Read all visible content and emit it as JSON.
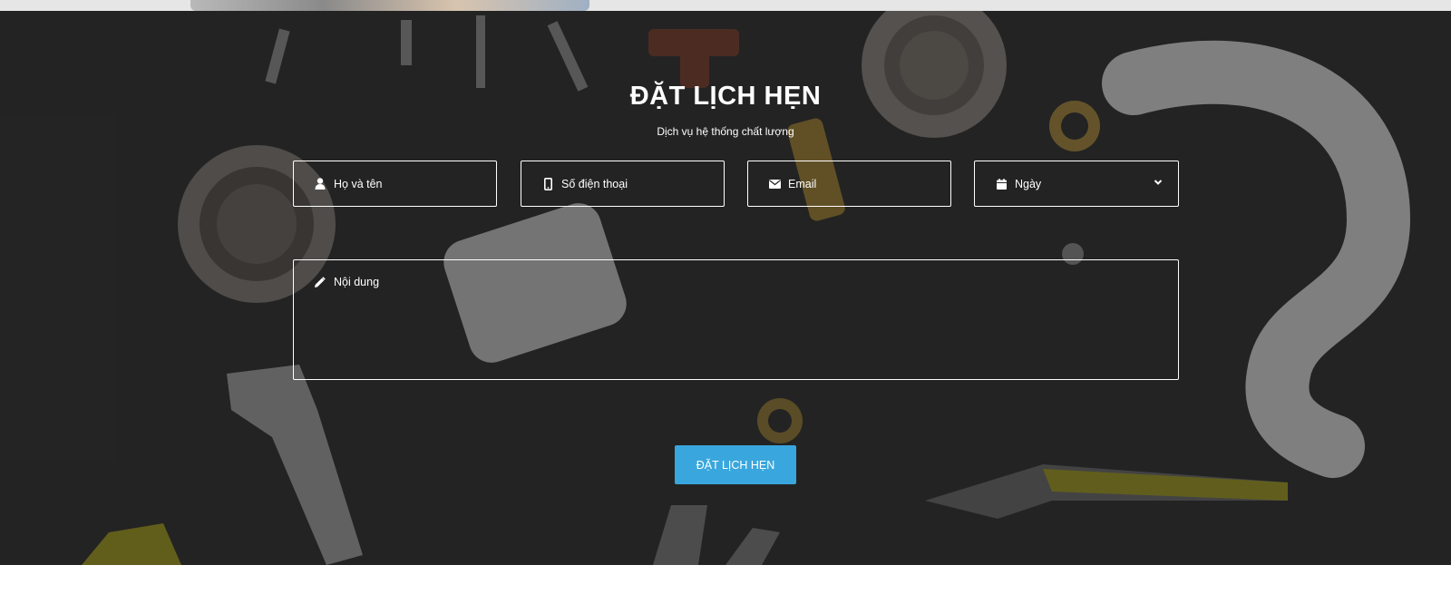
{
  "section": {
    "title": "ĐẶT LỊCH HẸN",
    "subtitle": "Dịch vụ hệ thống chất lượng"
  },
  "form": {
    "name_placeholder": "Họ và tên",
    "phone_placeholder": "Số điện thoại",
    "email_placeholder": "Email",
    "date_placeholder": "Ngày",
    "content_placeholder": "Nội dung",
    "submit_label": "ĐẶT LỊCH HẸN"
  },
  "icons": {
    "name": "user-icon",
    "phone": "mobile-phone-icon",
    "email": "envelope-icon",
    "date": "calendar-icon",
    "date_dropdown": "chevron-down-icon",
    "content": "pencil-icon"
  },
  "colors": {
    "accent": "#39a7dd",
    "background": "#2b2b2b",
    "field_border": "#ffffff"
  }
}
